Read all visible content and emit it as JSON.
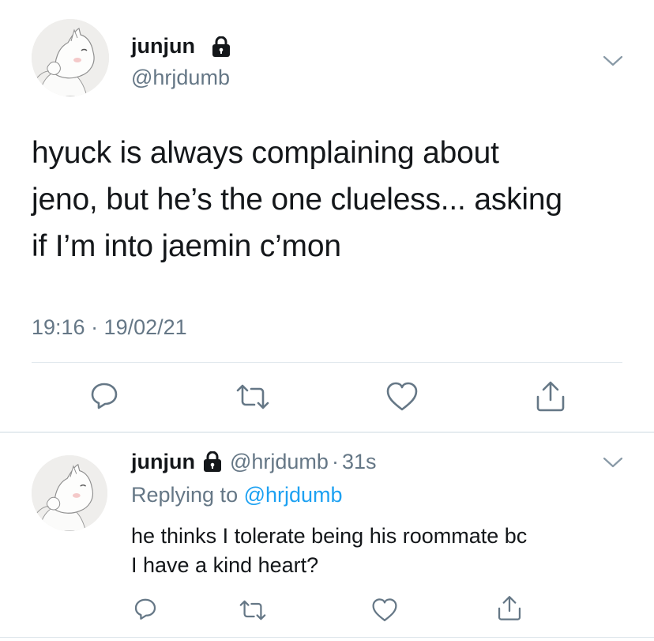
{
  "main_tweet": {
    "name": "junjun",
    "handle": "@hrjdumb",
    "text_lines": [
      "hyuck is always complaining about",
      "jeno, but he’s the one clueless... asking",
      "if I’m into jaemin c’mon"
    ],
    "timestamp": "19:16 · 19/02/21",
    "icons": [
      "lock-icon",
      "chevron-down-icon",
      "reply-icon",
      "retweet-icon",
      "like-icon",
      "share-icon"
    ]
  },
  "reply_tweet": {
    "name": "junjun",
    "handle": "@hrjdumb",
    "dot": "·",
    "time": "31s",
    "replying_prefix": "Replying to",
    "replying_to": "@hrjdumb",
    "text_lines": [
      "he thinks I tolerate being his roommate bc",
      "I have a kind heart?"
    ]
  },
  "colors": {
    "text": "#14171a",
    "secondary": "#657786",
    "link": "#1da1f2",
    "divider": "#e1e8ed"
  }
}
